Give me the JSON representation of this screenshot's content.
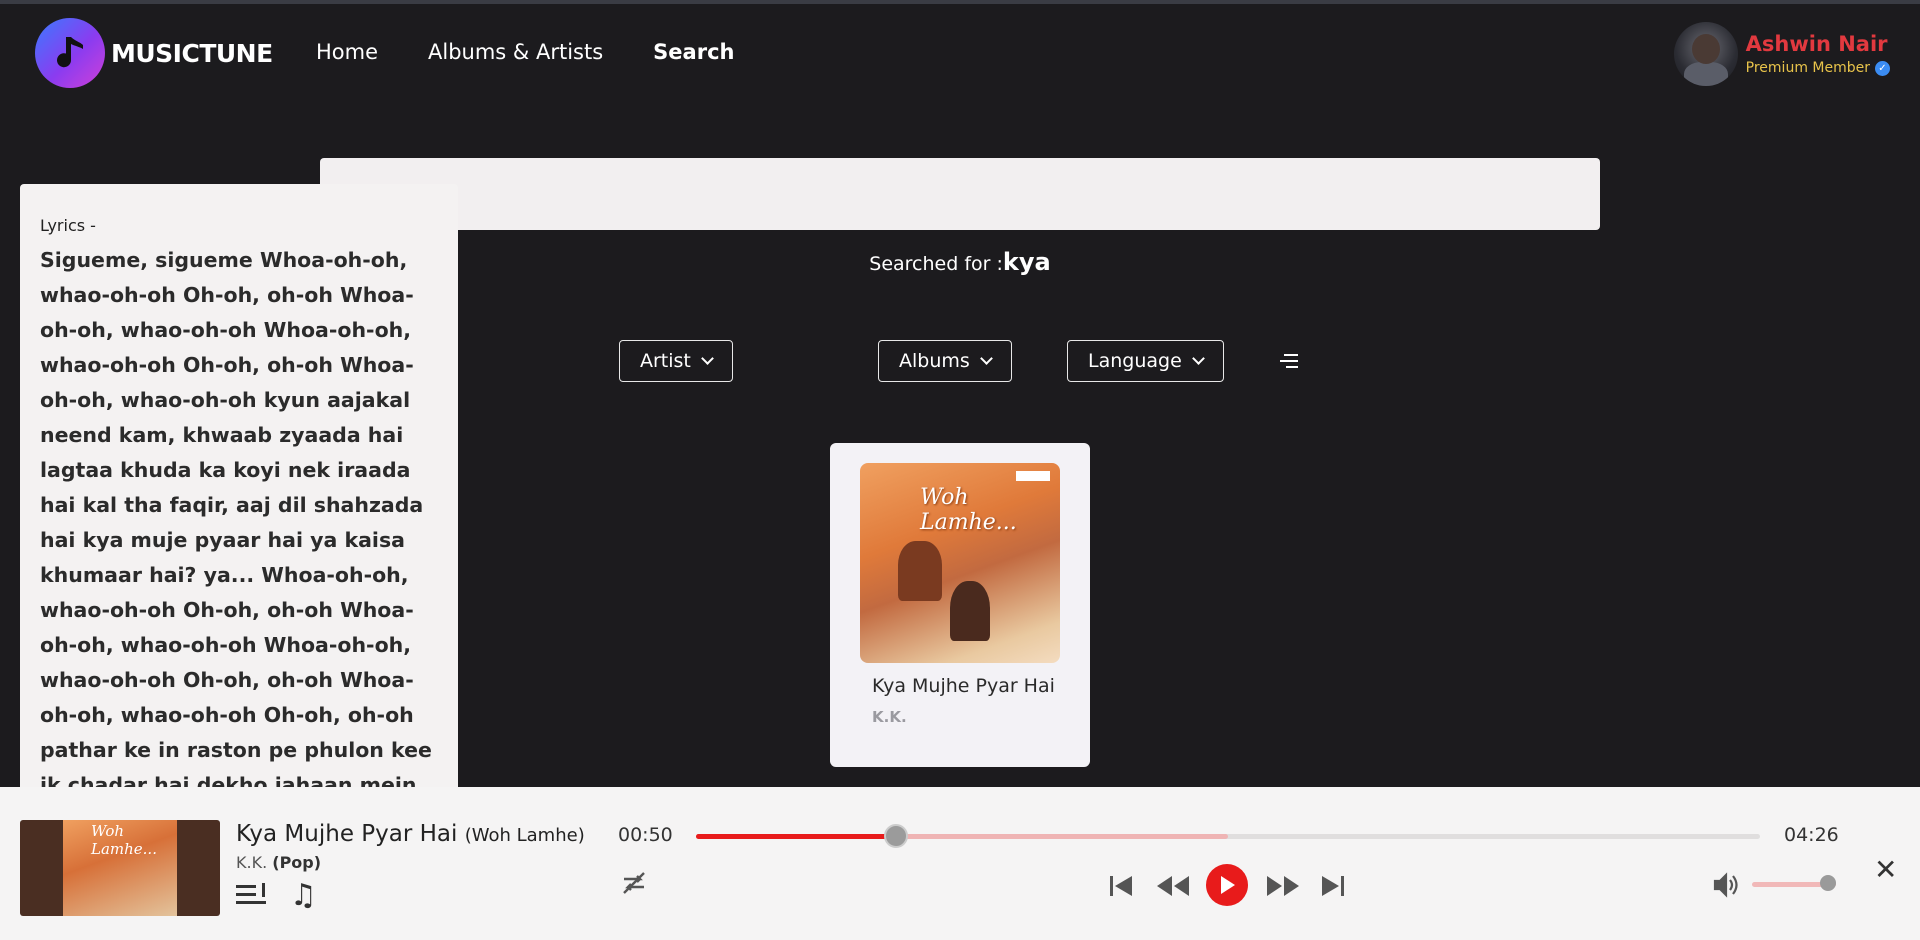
{
  "app": {
    "brand": "MUSICTUNE",
    "logo_icon": "music-note-icon"
  },
  "nav": {
    "items": [
      {
        "label": "Home",
        "active": false
      },
      {
        "label": "Albums & Artists",
        "active": false
      },
      {
        "label": "Search",
        "active": true
      }
    ]
  },
  "user": {
    "name": "Ashwin Nair",
    "membership": "Premium Member"
  },
  "search": {
    "value": "",
    "searched_prefix": "Searched for :",
    "query": "kya"
  },
  "filters": {
    "artist": "Artist",
    "albums": "Albums",
    "language": "Language"
  },
  "results": [
    {
      "title": "Kya Mujhe Pyar Hai",
      "artist": "K.K.",
      "album_art_text": "Woh Lamhe..."
    }
  ],
  "lyrics": {
    "label": "Lyrics -",
    "text": "Sigueme, sigueme Whoa-oh-oh, whao-oh-oh Oh-oh, oh-oh Whoa-oh-oh, whao-oh-oh Whoa-oh-oh, whao-oh-oh Oh-oh, oh-oh Whoa-oh-oh, whao-oh-oh kyun aajakal neend kam, khwaab zyaada hai lagtaa khuda ka koyi nek iraada hai kal tha faqir, aaj dil shahzada hai kya muje pyaar hai ya kaisa khumaar hai? ya... Whoa-oh-oh, whao-oh-oh Oh-oh, oh-oh Whoa-oh-oh, whao-oh-oh Whoa-oh-oh, whao-oh-oh Oh-oh, oh-oh Whoa-oh-oh, whao-oh-oh Oh-oh, oh-oh pathar ke in raston pe phulon kee ik chadar hai dekho jahaan mein nile-nile aasamaan tale rang nae-nae hain jaise ghulte hue soe se khwaab mere jaage tere"
  },
  "player": {
    "title": "Kya Mujhe Pyar Hai",
    "album": "(Woh Lamhe)",
    "artist": "K.K.",
    "genre": "(Pop)",
    "current_time": "00:50",
    "total_time": "04:26",
    "progress_fraction": 0.188,
    "buffered_fraction": 0.5,
    "volume_fraction": 0.9,
    "accent_color": "#e81b1b"
  }
}
